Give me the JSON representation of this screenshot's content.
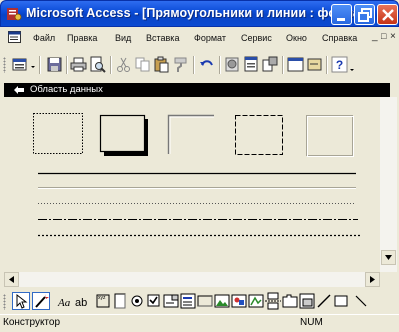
{
  "window": {
    "title": "Microsoft Access - [Прямоугольники и линии : форма]"
  },
  "menu": {
    "items": [
      "Файл",
      "Правка",
      "Вид",
      "Вставка",
      "Формат",
      "Сервис",
      "Окно",
      "Справка"
    ],
    "minimize_glyph": "_",
    "restore_glyph": "□",
    "close_glyph": "×"
  },
  "form": {
    "section_label": "Область данных"
  },
  "status": {
    "mode": "Конструктор",
    "num": "NUM"
  },
  "colors": {
    "titlebar": "#0a4bd6",
    "form_background": "#ece9d8",
    "section_header": "#000000"
  }
}
